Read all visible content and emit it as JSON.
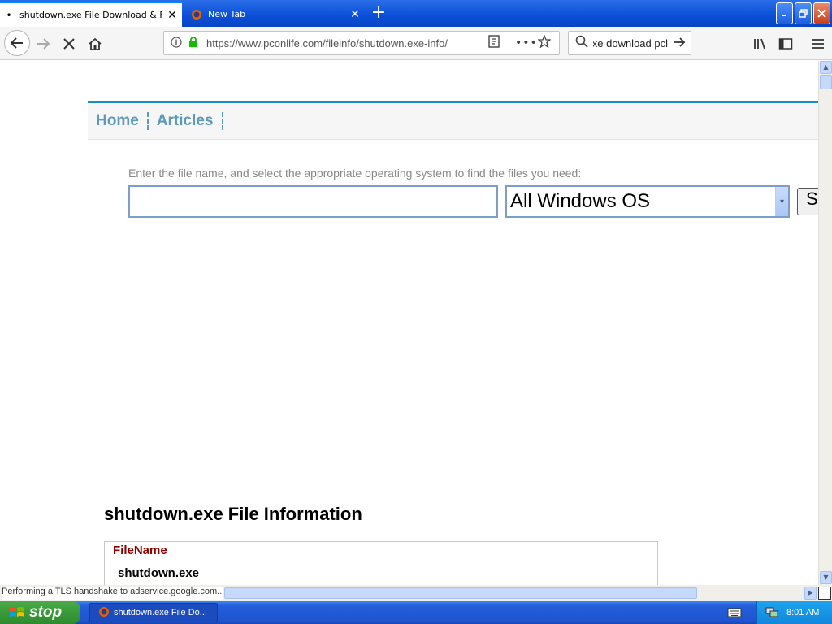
{
  "tabs": [
    {
      "label": "shutdown.exe File Download & Fix",
      "active": true
    },
    {
      "label": "New Tab",
      "active": false
    }
  ],
  "nav": {
    "url": "https://www.pconlife.com/fileinfo/shutdown.exe-info/",
    "search_value": "exe download pcl"
  },
  "site": {
    "nav_links": [
      "Home",
      "Articles"
    ],
    "search_hint": "Enter the file name, and select the appropriate operating system to find the files you need:",
    "file_input_value": "",
    "os_select_value": "All Windows OS",
    "submit_label": "S",
    "info_heading": "shutdown.exe File Information",
    "filename_label": "FileName",
    "filename_value": "shutdown.exe"
  },
  "status": {
    "text": "Performing a TLS handshake to adservice.google.com..."
  },
  "taskbar": {
    "start_label": "stop",
    "task_label": "shutdown.exe File Do...",
    "clock": "8:01 AM"
  },
  "colors": {
    "accent": "#1a8fbf",
    "link": "#5d9ab8",
    "label": "#8b0000",
    "taskbar": "#245edb",
    "start": "#3a9a3a"
  }
}
